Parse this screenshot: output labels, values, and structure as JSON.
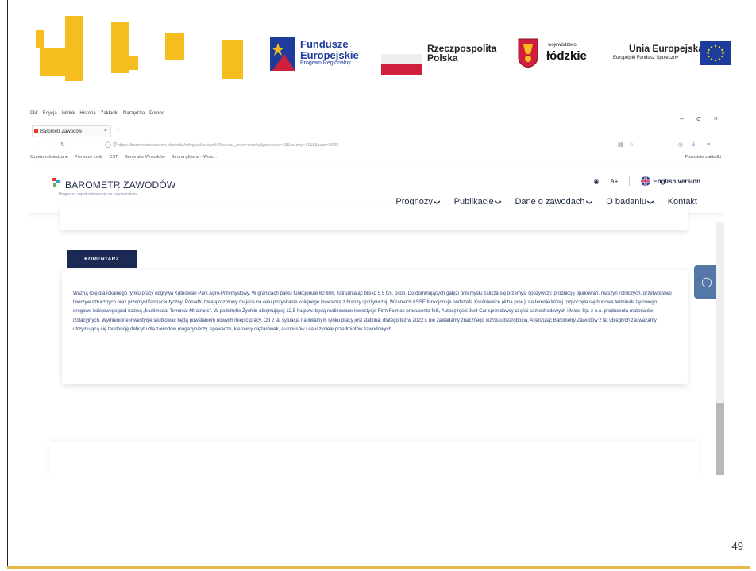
{
  "slide": {
    "page_number": "49"
  },
  "logos": {
    "fe_title1": "Fundusze",
    "fe_title2": "Europejskie",
    "fe_sub": "Program Regionalny",
    "rp_title1": "Rzeczpospolita",
    "rp_title2": "Polska",
    "lodz_small": "województwo",
    "lodz_big": "łódzkie",
    "ue_title": "Unia Europejska",
    "ue_sub": "Europejski Fundusz Społeczny"
  },
  "browser": {
    "menu": [
      "Plik",
      "Edycja",
      "Widok",
      "Historia",
      "Zakładki",
      "Narzędzia",
      "Pomoc"
    ],
    "tab_label": "Barometr Zawodów",
    "tab_close": "×",
    "tab_add": "+",
    "url": "https://barometrzawodow.pl/modul/infografika-wynik?kwezat_area=county&province=10&county=1158&year=2022",
    "bookmarks": [
      "Często odwiedzane",
      "Pierwsze kroki",
      "CST",
      "Generator Wniosków",
      "Strona główna - Woje..."
    ],
    "other_bookmarks": "Pozostałe zakładki",
    "win_min": "–",
    "win_max": "σ",
    "win_close": "×"
  },
  "site": {
    "brand_name": "BAROMETR ZAWODÓW",
    "brand_sub": "Prognoza zapotrzebowania na pracowników",
    "a_plus": "A+",
    "english": "English version",
    "nav": [
      "Prognozy",
      "Publikacje",
      "Dane o zawodach",
      "O badaniu",
      "Kontakt"
    ],
    "caret": "❯"
  },
  "comment": {
    "tab_label": "KOMENTARZ",
    "text": "Ważną rolę dla lokalnego rynku pracy odgrywa Kutnowski Park Agro-Przemysłowy. W granicach parku funkcjonuje 60 firm, zatrudniając blisko 5,5 tys. osób. Do dominujących gałęzi przemysłu zalicza się przemysł spożywczy, produkcję opakowań, maszyn rolniczych, przetwórstwo tworzyw sztucznych oraz przemysł farmaceutyczny. Ponadto trwają rozmowy mające na celu pozyskanie kolejnego inwestora z branży spożywczej. W ramach ŁSSE funkcjonuje podstrefa Krośniewice (4 ha pow.), na terenie której rozpoczęła się budowa terminala lądowego drogowo kolejowego pod nazwą „Multimodal Terminal Miratrans\". W podstrefie Żychlin obejmującej 12,5 ha pow. będą realizowane inwestycje Firm Folmax producenta folii, Autocężęści Just Car sprzedawcy części samochodowych i Micel Sp. z o.o. producenta materiałów izolacyjnych. Wymienione inwestycje skutkować będą powstaniem nowych miejsc pracy. Od 2 lat sytuacja na lokalnym rynku pracy jest stabilna, dlatego też w 2022 r. nie zakładamy znacznego wzrostu bezrobocia. Analizując Barometry Zawodów z lat ubiegłych zauważamy utrzymującą się tendencję deficytu dla zawodów magazynierzy, spawacze, kierowcy ciężarówek, autobusów i nauczyciele przedmiotów zawodowych."
  },
  "colors": {
    "accent_dark": "#1b2a55",
    "fe_yellow": "#f6bd1f",
    "side_button": "#5577a8"
  }
}
